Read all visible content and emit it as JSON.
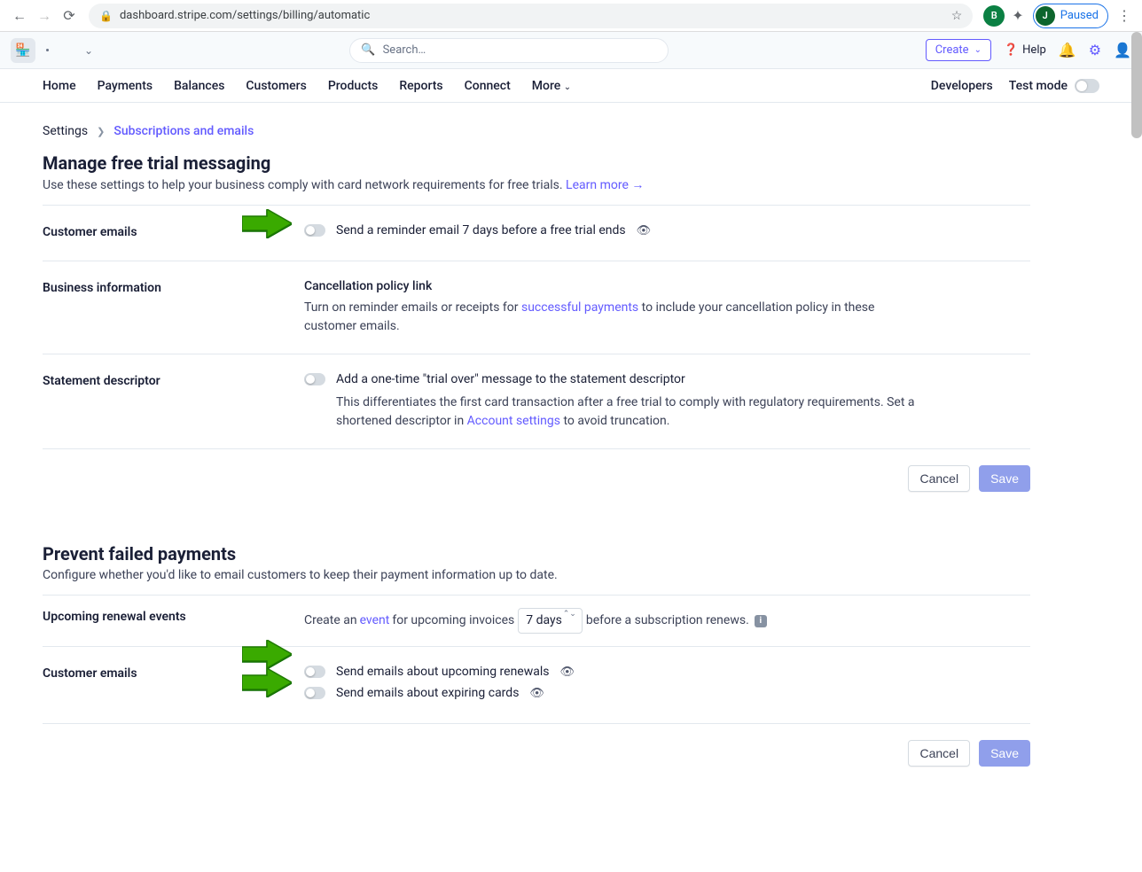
{
  "browser": {
    "url": "dashboard.stripe.com/settings/billing/automatic",
    "paused_label": "Paused",
    "avatar_initial": "J",
    "ext_initial": "B"
  },
  "header": {
    "search_placeholder": "Search…",
    "create_label": "Create",
    "help_label": "Help"
  },
  "nav": {
    "items": [
      "Home",
      "Payments",
      "Balances",
      "Customers",
      "Products",
      "Reports",
      "Connect",
      "More"
    ],
    "developers": "Developers",
    "test_mode": "Test mode"
  },
  "breadcrumb": {
    "root": "Settings",
    "current": "Subscriptions and emails"
  },
  "section1": {
    "title": "Manage free trial messaging",
    "desc_pre": "Use these settings to help your business comply with card network requirements for free trials. ",
    "learn_more": "Learn more",
    "row1_label": "Customer emails",
    "row1_toggle_label": "Send a reminder email 7 days before a free trial ends",
    "row2_label": "Business information",
    "row2_subtitle": "Cancellation policy link",
    "row2_text_pre": "Turn on reminder emails or receipts for ",
    "row2_link": "successful payments",
    "row2_text_post": " to include your cancellation policy in these customer emails.",
    "row3_label": "Statement descriptor",
    "row3_toggle_label": "Add a one-time \"trial over\" message to the statement descriptor",
    "row3_text_pre": "This differentiates the first card transaction after a free trial to comply with regulatory requirements. Set a shortened descriptor in ",
    "row3_link": "Account settings",
    "row3_text_post": " to avoid truncation."
  },
  "actions": {
    "cancel": "Cancel",
    "save": "Save"
  },
  "section2": {
    "title": "Prevent failed payments",
    "desc": "Configure whether you'd like to email customers to keep their payment information up to date.",
    "row1_label": "Upcoming renewal events",
    "row1_text_pre": "Create an ",
    "row1_link": "event",
    "row1_text_mid": " for upcoming invoices ",
    "row1_select": "7 days",
    "row1_text_post": " before a subscription renews.",
    "row2_label": "Customer emails",
    "row2_toggle1": "Send emails about upcoming renewals",
    "row2_toggle2": "Send emails about expiring cards"
  }
}
